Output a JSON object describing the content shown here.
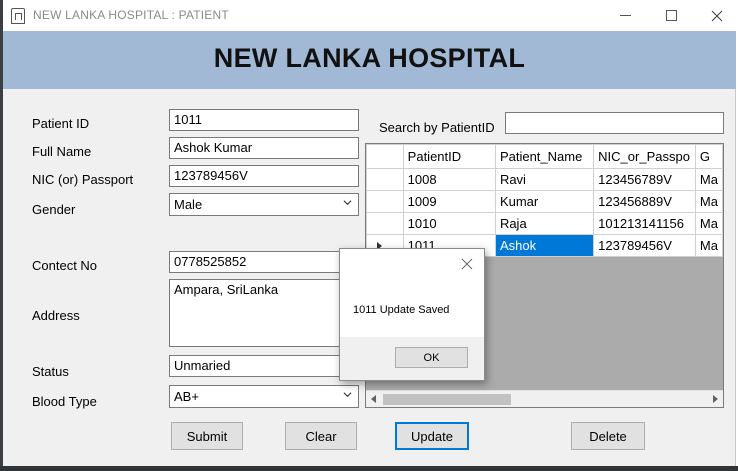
{
  "window": {
    "title": "NEW LANKA HOSPITAL : PATIENT"
  },
  "banner": {
    "title": "NEW LANKA HOSPITAL"
  },
  "form": {
    "patient_id_label": "Patient ID",
    "patient_id_value": "1011",
    "full_name_label": "Full Name",
    "full_name_value": "Ashok Kumar",
    "nic_label": "NIC (or) Passport",
    "nic_value": "123789456V",
    "gender_label": "Gender",
    "gender_value": "Male",
    "contact_label": "Contect No",
    "contact_value": "0778525852",
    "address_label": "Address",
    "address_value": "Ampara, SriLanka",
    "status_label": "Status",
    "status_value": "Unmaried",
    "blood_label": "Blood Type",
    "blood_value": "AB+"
  },
  "search": {
    "label": "Search by PatientID",
    "value": ""
  },
  "grid": {
    "columns": [
      "PatientID",
      "Patient_Name",
      "NIC_or_Passpo",
      "G"
    ],
    "rows": [
      [
        "1008",
        "Ravi",
        "123456789V",
        "Ma"
      ],
      [
        "1009",
        "Kumar",
        "123456889V",
        "Ma"
      ],
      [
        "1010",
        "Raja",
        "101213141156",
        "Ma"
      ],
      [
        "1011",
        "Ashok",
        "123789456V",
        "Ma"
      ]
    ]
  },
  "buttons": {
    "submit": "Submit",
    "clear": "Clear",
    "update": "Update",
    "delete": "Delete"
  },
  "dialog": {
    "message": "1011 Update Saved",
    "ok": "OK"
  },
  "colors": {
    "banner": "#a2b9d5",
    "selection": "#0078d7"
  },
  "icons": {
    "app": "hospital-app-icon",
    "close": "close-icon",
    "chevron": "chevron-down-icon"
  }
}
